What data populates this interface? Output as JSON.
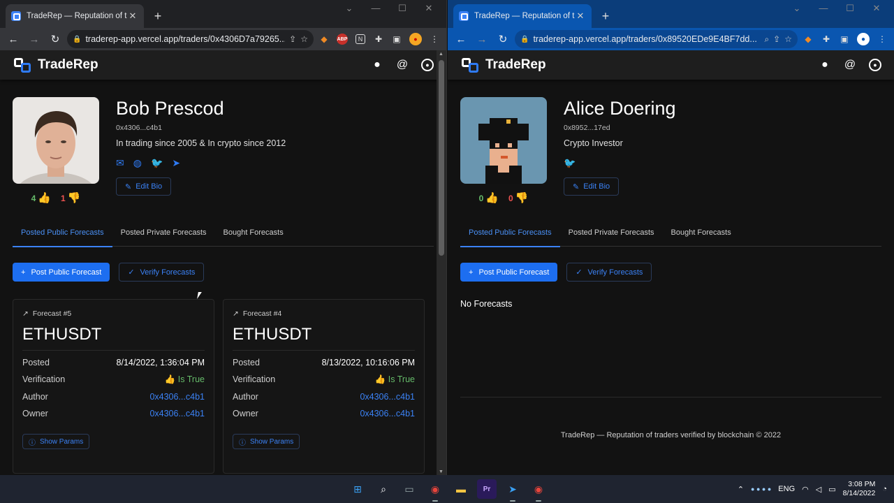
{
  "left": {
    "tab_title": "TradeRep — Reputation of trader",
    "url": "traderep-app.vercel.app/traders/0x4306D7a79265...",
    "brand": "TradeRep",
    "trader": {
      "name": "Bob Prescod",
      "address": "0x4306...c4b1",
      "bio": "In trading since 2005 & In crypto since 2012",
      "up_votes": "4",
      "down_votes": "1",
      "edit_bio": "Edit Bio"
    },
    "tabs": [
      "Posted Public Forecasts",
      "Posted Private Forecasts",
      "Bought Forecasts"
    ],
    "post_button": "Post Public Forecast",
    "verify_button": "Verify Forecasts",
    "forecasts": [
      {
        "title": "Forecast #5",
        "symbol": "ETHUSDT",
        "rows": [
          {
            "label": "Posted",
            "value": "8/14/2022, 1:36:04 PM"
          },
          {
            "label": "Verification",
            "value": "Is True"
          },
          {
            "label": "Author",
            "value": "0x4306...c4b1"
          },
          {
            "label": "Owner",
            "value": "0x4306...c4b1"
          }
        ],
        "show_params": "Show Params"
      },
      {
        "title": "Forecast #4",
        "symbol": "ETHUSDT",
        "rows": [
          {
            "label": "Posted",
            "value": "8/13/2022, 10:16:06 PM"
          },
          {
            "label": "Verification",
            "value": "Is True"
          },
          {
            "label": "Author",
            "value": "0x4306...c4b1"
          },
          {
            "label": "Owner",
            "value": "0x4306...c4b1"
          }
        ],
        "show_params": "Show Params"
      }
    ]
  },
  "right": {
    "tab_title": "TradeRep — Reputation of trader",
    "url": "traderep-app.vercel.app/traders/0x89520EDe9E4BF7dd...",
    "brand": "TradeRep",
    "trader": {
      "name": "Alice Doering",
      "address": "0x8952...17ed",
      "bio": "Crypto Investor",
      "up_votes": "0",
      "down_votes": "0",
      "edit_bio": "Edit Bio"
    },
    "tabs": [
      "Posted Public Forecasts",
      "Posted Private Forecasts",
      "Bought Forecasts"
    ],
    "post_button": "Post Public Forecast",
    "verify_button": "Verify Forecasts",
    "empty": "No Forecasts",
    "footer": "TradeRep — Reputation of traders verified by blockchain © 2022"
  },
  "taskbar": {
    "lang": "ENG",
    "time": "3:08 PM",
    "date": "8/14/2022"
  },
  "colors": {
    "accent": "#3b82f6",
    "positive": "#66bb6a",
    "negative": "#ef5350"
  }
}
